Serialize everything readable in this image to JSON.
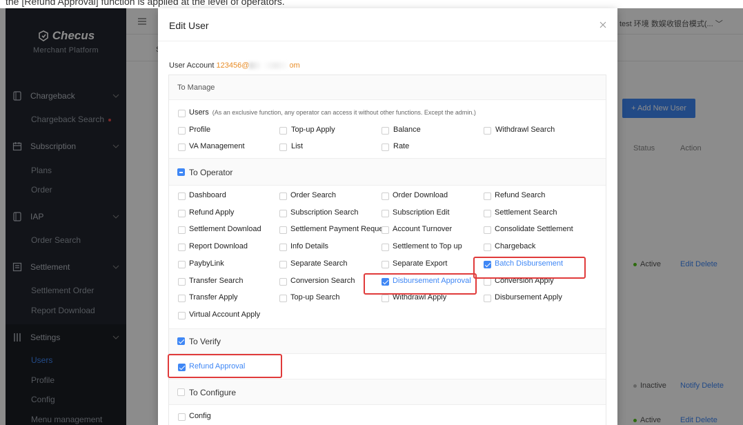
{
  "top_strip_text": "the [Refund Approval] function is applied at the level of operators.",
  "sidebar": {
    "brand": "Checus",
    "brand_sub": "Merchant Platform",
    "groups": [
      {
        "label": "Chargeback",
        "subs": [
          {
            "label": "Chargeback Search"
          }
        ]
      },
      {
        "label": "Subscription",
        "subs": [
          {
            "label": "Plans"
          },
          {
            "label": "Order"
          }
        ]
      },
      {
        "label": "IAP",
        "subs": [
          {
            "label": "Order Search"
          }
        ]
      },
      {
        "label": "Settlement",
        "subs": [
          {
            "label": "Settlement Order"
          },
          {
            "label": "Report Download"
          }
        ]
      },
      {
        "label": "Settings",
        "subs": [
          {
            "label": "Users"
          },
          {
            "label": "Profile"
          },
          {
            "label": "Config"
          },
          {
            "label": "Menu management"
          }
        ]
      }
    ]
  },
  "background": {
    "tab": "S",
    "user_env": "test 环境 数娱收银台模式(...",
    "add_button": "+ Add New User",
    "col_status": "Status",
    "col_action": "Action",
    "rows": [
      {
        "status": "Active",
        "actions": [
          "Edit",
          "Delete"
        ]
      },
      {
        "status": "Inactive",
        "actions": [
          "Notify",
          "Delete"
        ]
      },
      {
        "status": "Active",
        "actions": [
          "Edit",
          "Delete"
        ]
      }
    ]
  },
  "modal": {
    "title": "Edit User",
    "account_label": "User Account",
    "account_value_start": "123456@",
    "account_value_end": "om",
    "sections": {
      "manage": {
        "title": "To Manage"
      },
      "operator": {
        "title": "To Operator"
      },
      "verify": {
        "title": "To Verify"
      },
      "configure": {
        "title": "To Configure"
      }
    },
    "users_label": "Users",
    "users_note": "(As an exclusive function, any operator can access it without other functions. Except the admin.)",
    "manage_items": [
      "Profile",
      "Top-up Apply",
      "Balance",
      "Withdrawl Search",
      "VA Management",
      "List",
      "Rate"
    ],
    "operator_items": [
      "Dashboard",
      "Order Search",
      "Order Download",
      "Refund Search",
      "Refund Apply",
      "Subscription Search",
      "Subscription Edit",
      "Settlement Search",
      "Settlement Download",
      "Settlement Payment Reque",
      "Account Turnover",
      "Consolidate Settlement",
      "Report Download",
      "Info Details",
      "Settlement to Top up",
      "Chargeback",
      "PaybyLink",
      "Separate Search",
      "Separate Export",
      "Batch Disbursement",
      "Transfer Search",
      "Conversion Search",
      "Disbursement Approval",
      "Conversion Apply",
      "Transfer Apply",
      "Top-up Search",
      "Withdrawl Apply",
      "Disbursement Apply",
      "Virtual Account Apply"
    ],
    "verify_items": [
      "Refund Approval"
    ],
    "configure_items": [
      "Config"
    ]
  },
  "colors": {
    "accent": "#3f87f5",
    "highlight": "#e03a3a",
    "account": "#e88b24"
  }
}
